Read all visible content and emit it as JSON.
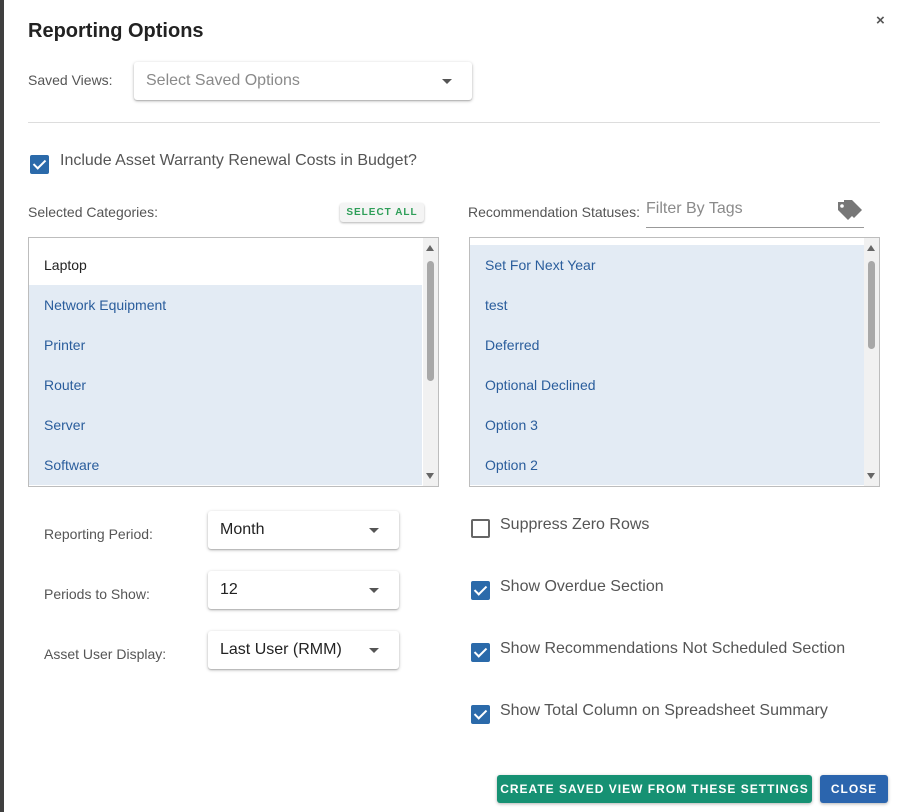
{
  "dialog": {
    "title": "Reporting Options",
    "close_glyph": "×"
  },
  "saved_views": {
    "label": "Saved Views:",
    "placeholder": "Select Saved Options"
  },
  "include_warranty": {
    "label": "Include Asset Warranty Renewal Costs in Budget?",
    "checked": true
  },
  "categories": {
    "label": "Selected Categories:",
    "select_all_label": "SELECT ALL",
    "items": [
      {
        "label": "Laptop",
        "selected": false
      },
      {
        "label": "Network Equipment",
        "selected": true
      },
      {
        "label": "Printer",
        "selected": true
      },
      {
        "label": "Router",
        "selected": true
      },
      {
        "label": "Server",
        "selected": true
      },
      {
        "label": "Software",
        "selected": true
      }
    ]
  },
  "statuses": {
    "label": "Recommendation Statuses:",
    "filter_placeholder": "Filter By Tags",
    "items": [
      {
        "label": "Set For Next Year",
        "selected": true
      },
      {
        "label": "test",
        "selected": true
      },
      {
        "label": "Deferred",
        "selected": true
      },
      {
        "label": "Optional Declined",
        "selected": true
      },
      {
        "label": "Option 3",
        "selected": true
      },
      {
        "label": "Option 2",
        "selected": true
      }
    ]
  },
  "reporting_period": {
    "label": "Reporting Period:",
    "value": "Month"
  },
  "periods_to_show": {
    "label": "Periods to Show:",
    "value": "12"
  },
  "asset_user_display": {
    "label": "Asset User Display:",
    "value": "Last User (RMM)"
  },
  "options": {
    "suppress_zero_rows": {
      "label": "Suppress Zero Rows",
      "checked": false
    },
    "show_overdue": {
      "label": "Show Overdue Section",
      "checked": true
    },
    "show_not_scheduled": {
      "label": "Show Recommendations Not Scheduled Section",
      "checked": true
    },
    "show_total_column": {
      "label": "Show Total Column on Spreadsheet Summary",
      "checked": true
    }
  },
  "footer": {
    "create_label": "CREATE SAVED VIEW FROM THESE SETTINGS",
    "close_label": "CLOSE"
  },
  "colors": {
    "accent_blue": "#2b6aaa",
    "green_button": "#169173",
    "blue_button": "#2b65ae",
    "selected_row": "#e3ebf4"
  },
  "icons": {
    "tag": "tag-icon",
    "dropdown": "chevron-down-icon",
    "close": "close-icon"
  }
}
